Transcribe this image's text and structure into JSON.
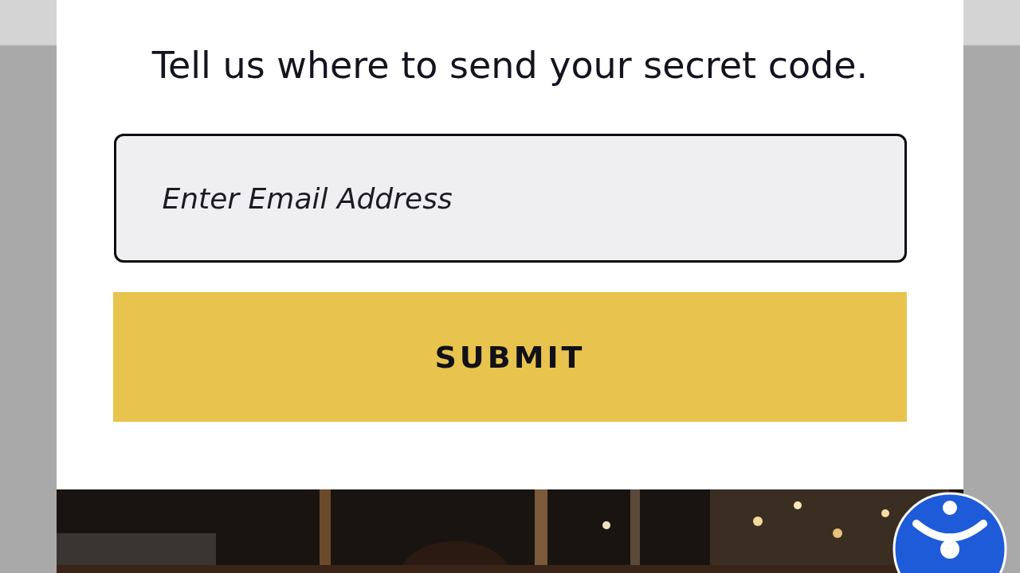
{
  "heading": "Tell us where to send your secret code.",
  "email_field": {
    "placeholder": "Enter Email Address"
  },
  "submit_button": {
    "label": "SUBMIT"
  }
}
